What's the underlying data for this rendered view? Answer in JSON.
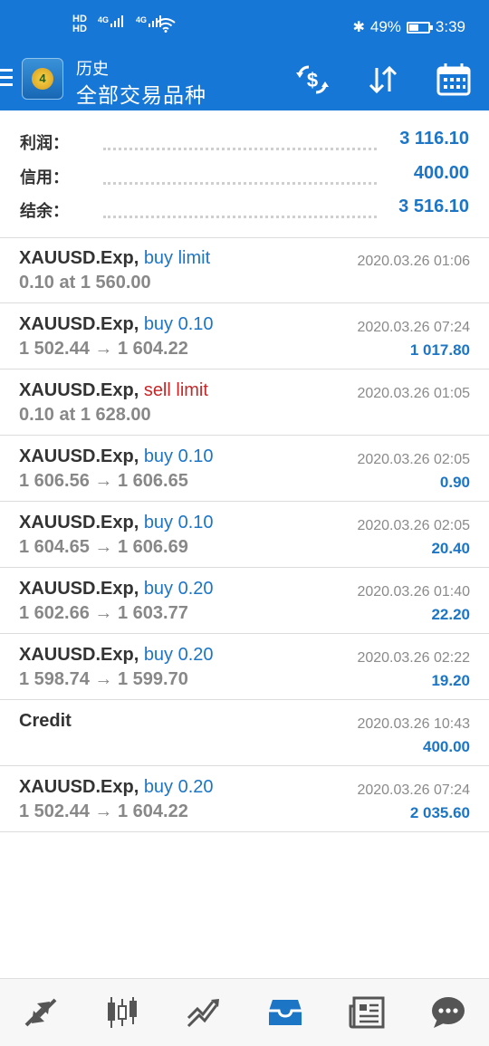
{
  "status_bar": {
    "sim_labels": [
      "HD",
      "HD"
    ],
    "network": [
      "4G",
      "4G"
    ],
    "battery": "49%",
    "battery_fraction": 0.49,
    "time": "3:39"
  },
  "app_bar": {
    "section": "历史",
    "filter": "全部交易品种",
    "icons": [
      "menu-icon",
      "app-logo-icon",
      "currency-exchange-icon",
      "sort-icon",
      "calendar-icon"
    ]
  },
  "summary": [
    {
      "label": "利润：",
      "value": "3 116.10"
    },
    {
      "label": "信用：",
      "value": "400.00"
    },
    {
      "label": "结余：",
      "value": "3 516.10"
    }
  ],
  "trades": [
    {
      "symbol": "XAUUSD.Exp,",
      "type": "buy limit",
      "type_color": "blue",
      "detail": "0.10 at 1 560.00",
      "time": "2020.03.26 01:06",
      "profit": ""
    },
    {
      "symbol": "XAUUSD.Exp,",
      "type": "buy 0.10",
      "type_color": "blue",
      "detail": "1 502.44 → 1 604.22",
      "time": "2020.03.26 07:24",
      "profit": "1 017.80"
    },
    {
      "symbol": "XAUUSD.Exp,",
      "type": "sell limit",
      "type_color": "red",
      "detail": "0.10 at 1 628.00",
      "time": "2020.03.26 01:05",
      "profit": ""
    },
    {
      "symbol": "XAUUSD.Exp,",
      "type": "buy 0.10",
      "type_color": "blue",
      "detail": "1 606.56 → 1 606.65",
      "time": "2020.03.26 02:05",
      "profit": "0.90"
    },
    {
      "symbol": "XAUUSD.Exp,",
      "type": "buy 0.10",
      "type_color": "blue",
      "detail": "1 604.65 → 1 606.69",
      "time": "2020.03.26 02:05",
      "profit": "20.40"
    },
    {
      "symbol": "XAUUSD.Exp,",
      "type": "buy 0.20",
      "type_color": "blue",
      "detail": "1 602.66 → 1 603.77",
      "time": "2020.03.26 01:40",
      "profit": "22.20"
    },
    {
      "symbol": "XAUUSD.Exp,",
      "type": "buy 0.20",
      "type_color": "blue",
      "detail": "1 598.74 → 1 599.70",
      "time": "2020.03.26 02:22",
      "profit": "19.20"
    },
    {
      "symbol": "Credit",
      "type": "",
      "type_color": "blue",
      "detail": "",
      "time": "2020.03.26 10:43",
      "profit": "400.00"
    },
    {
      "symbol": "XAUUSD.Exp,",
      "type": "buy 0.20",
      "type_color": "blue",
      "detail": "1 502.44 → 1 604.22",
      "time": "2020.03.26 07:24",
      "profit": "2 035.60"
    }
  ],
  "bottom_nav": {
    "items": [
      "quotes-icon",
      "chart-candles-icon",
      "trade-icon",
      "history-icon",
      "news-icon",
      "chat-icon"
    ],
    "active": "history-icon",
    "active_color": "#1c75c5",
    "inactive_color": "#555555"
  },
  "colors": {
    "brand": "#1677d6",
    "value_blue": "#1c75c5",
    "sell_red": "#c62828"
  }
}
